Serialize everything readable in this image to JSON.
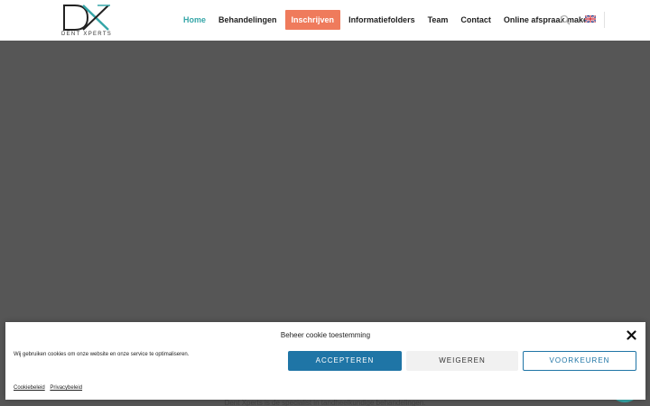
{
  "header": {
    "logo_text": "DENT XPERTS",
    "nav": [
      {
        "label": "Home",
        "state": "active"
      },
      {
        "label": "Behandelingen",
        "state": "normal"
      },
      {
        "label": "Inschrijven",
        "state": "highlight"
      },
      {
        "label": "Informatiefolders",
        "state": "normal"
      },
      {
        "label": "Team",
        "state": "normal"
      },
      {
        "label": "Contact",
        "state": "normal"
      },
      {
        "label": "Online afspraak maken",
        "state": "normal"
      }
    ],
    "search_icon": "search-icon",
    "language_icon": "uk-flag-icon"
  },
  "page": {
    "intro_text": "Dent Xperts is de specialist in tandheelkundige behandelingen."
  },
  "cookie_banner": {
    "title": "Beheer cookie toestemming",
    "message": "Wij gebruiken cookies om onze website en onze service te optimaliseren.",
    "accept_label": "ACCEPTEREN",
    "deny_label": "WEIGEREN",
    "preferences_label": "VOORKEUREN",
    "links": [
      "Cookiebeleid",
      "Privacybeleid"
    ],
    "close_icon": "close-icon"
  },
  "colors": {
    "accent": "#35a6a8",
    "highlight": "#ef7b5c",
    "button_primary": "#1f75a6",
    "hero_background": "#565656"
  }
}
